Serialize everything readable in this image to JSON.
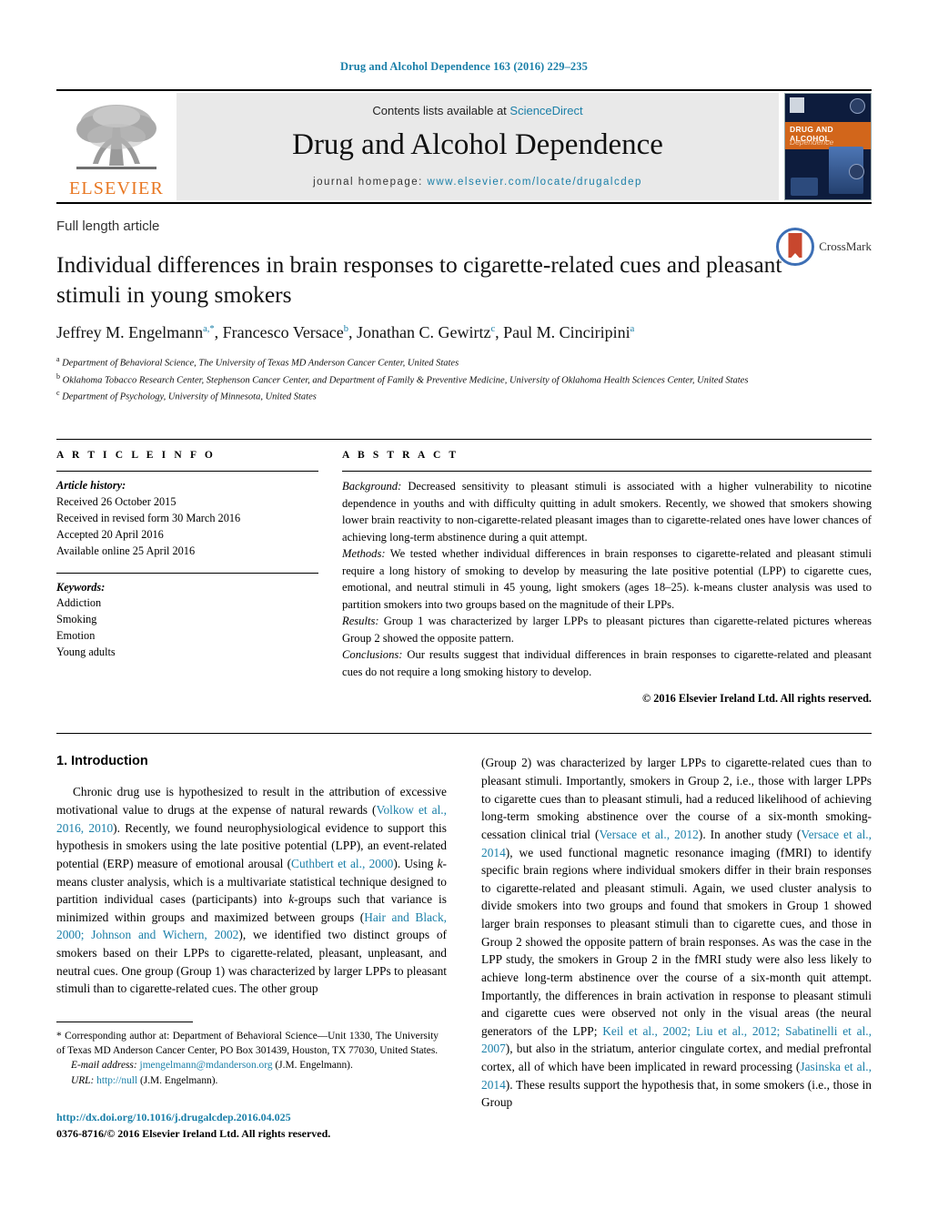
{
  "running_head": "Drug and Alcohol Dependence 163 (2016) 229–235",
  "masthead": {
    "contents_prefix": "Contents lists available at ",
    "sciencedirect": "ScienceDirect",
    "journal_name": "Drug and Alcohol Dependence",
    "homepage_prefix": "journal homepage: ",
    "homepage_url": "www.elsevier.com/locate/drugalcdep",
    "publisher": "ELSEVIER",
    "cover_title": "DRUG AND ALCOHOL",
    "cover_subtitle": "Dependence",
    "accent_blue": "#1a7fa8",
    "elsevier_orange": "#E87722"
  },
  "article": {
    "type_label": "Full length article",
    "title": "Individual differences in brain responses to cigarette-related cues and pleasant stimuli in young smokers",
    "authors_html": "Jeffrey M. Engelmann<sup>a,*</sup>, Francesco Versace<sup>b</sup>, Jonathan C. Gewirtz<sup>c</sup>, Paul M. Cinciripini<sup>a</sup>",
    "affiliations": [
      {
        "marker": "a",
        "text": "Department of Behavioral Science, The University of Texas MD Anderson Cancer Center, United States"
      },
      {
        "marker": "b",
        "text": "Oklahoma Tobacco Research Center, Stephenson Cancer Center, and Department of Family & Preventive Medicine, University of Oklahoma Health Sciences Center, United States"
      },
      {
        "marker": "c",
        "text": "Department of Psychology, University of Minnesota, United States"
      }
    ],
    "crossmark_label": "CrossMark"
  },
  "article_info": {
    "heading": "A R T I C L E   I N F O",
    "history_label": "Article history:",
    "history": [
      "Received 26 October 2015",
      "Received in revised form 30 March 2016",
      "Accepted 20 April 2016",
      "Available online 25 April 2016"
    ],
    "keywords_label": "Keywords:",
    "keywords": [
      "Addiction",
      "Smoking",
      "Emotion",
      "Young adults"
    ]
  },
  "abstract": {
    "heading": "A B S T R A C T",
    "background_label": "Background:",
    "background_text": " Decreased sensitivity to pleasant stimuli is associated with a higher vulnerability to nicotine dependence in youths and with difficulty quitting in adult smokers. Recently, we showed that smokers showing lower brain reactivity to non-cigarette-related pleasant images than to cigarette-related ones have lower chances of achieving long-term abstinence during a quit attempt.",
    "methods_label": "Methods:",
    "methods_text": " We tested whether individual differences in brain responses to cigarette-related and pleasant stimuli require a long history of smoking to develop by measuring the late positive potential (LPP) to cigarette cues, emotional, and neutral stimuli in 45 young, light smokers (ages 18–25). k-means cluster analysis was used to partition smokers into two groups based on the magnitude of their LPPs.",
    "results_label": "Results:",
    "results_text": " Group 1 was characterized by larger LPPs to pleasant pictures than cigarette-related pictures whereas Group 2 showed the opposite pattern.",
    "conclusions_label": "Conclusions:",
    "conclusions_text": " Our results suggest that individual differences in brain responses to cigarette-related and pleasant cues do not require a long smoking history to develop.",
    "copyright": "© 2016 Elsevier Ireland Ltd. All rights reserved."
  },
  "body": {
    "section_number_title": "1.  Introduction",
    "left_col_html": "Chronic drug use is hypothesized to result in the attribution of excessive motivational value to drugs at the expense of natural rewards (<span class=\"ref\">Volkow et al., 2016, 2010</span>). Recently, we found neurophysiological evidence to support this hypothesis in smokers using the late positive potential (LPP), an event-related potential (ERP) measure of emotional arousal (<span class=\"ref\">Cuthbert et al., 2000</span>). Using <span class=\"ital\">k</span>-means cluster analysis, which is a multivariate statistical technique designed to partition individual cases (participants) into <span class=\"ital\">k</span>-groups such that variance is minimized within groups and maximized between groups (<span class=\"ref\">Hair and Black, 2000; Johnson and Wichern, 2002</span>), we identified two distinct groups of smokers based on their LPPs to cigarette-related, pleasant, unpleasant, and neutral cues. One group (Group 1) was characterized by larger LPPs to pleasant stimuli than to cigarette-related cues. The other group",
    "right_col_html": "(Group 2) was characterized by larger LPPs to cigarette-related cues than to pleasant stimuli. Importantly, smokers in Group 2, i.e., those with larger LPPs to cigarette cues than to pleasant stimuli, had a reduced likelihood of achieving long-term smoking abstinence over the course of a six-month smoking-cessation clinical trial (<span class=\"ref\">Versace et al., 2012</span>). In another study (<span class=\"ref\">Versace et al., 2014</span>), we used functional magnetic resonance imaging (fMRI) to identify specific brain regions where individual smokers differ in their brain responses to cigarette-related and pleasant stimuli. Again, we used cluster analysis to divide smokers into two groups and found that smokers in Group 1 showed larger brain responses to pleasant stimuli than to cigarette cues, and those in Group 2 showed the opposite pattern of brain responses. As was the case in the LPP study, the smokers in Group 2 in the fMRI study were also less likely to achieve long-term abstinence over the course of a six-month quit attempt. Importantly, the differences in brain activation in response to pleasant stimuli and cigarette cues were observed not only in the visual areas (the neural generators of the LPP; <span class=\"ref\">Keil et al., 2002; Liu et al., 2012; Sabatinelli et al., 2007</span>), but also in the striatum, anterior cingulate cortex, and medial prefrontal cortex, all of which have been implicated in reward processing (<span class=\"ref\">Jasinska et al., 2014</span>). These results support the hypothesis that, in some smokers (i.e., those in Group"
  },
  "footnotes": {
    "corresponding_html": "*  Corresponding author at: Department of Behavioral Science—Unit 1330, The University of Texas MD Anderson Cancer Center, PO Box 301439, Houston, TX 77030, United States.",
    "email_label": "E-mail address:",
    "email": "jmengelmann@mdanderson.org",
    "email_attrib": "(J.M. Engelmann).",
    "url_label": "URL:",
    "url": "http://null",
    "url_attrib": "(J.M. Engelmann).",
    "doi": "http://dx.doi.org/10.1016/j.drugalcdep.2016.04.025",
    "issn_line": "0376-8716/© 2016 Elsevier Ireland Ltd. All rights reserved."
  }
}
